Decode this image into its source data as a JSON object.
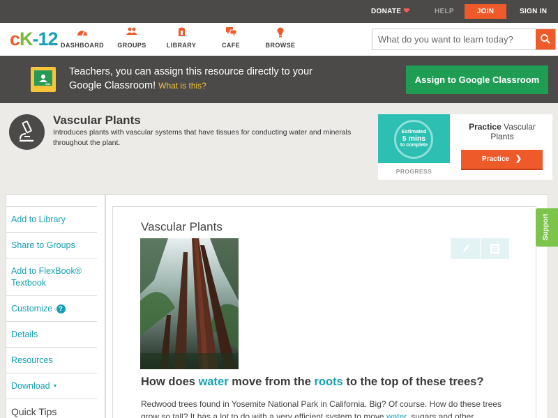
{
  "topbar": {
    "donate": "DONATE",
    "help": "HELP",
    "join": "JOIN",
    "signin": "SIGN IN"
  },
  "header": {
    "logo": {
      "c": "c",
      "k": "K",
      "n": "-12"
    },
    "nav": [
      {
        "label": "DASHBOARD",
        "icon": "dashboard-icon"
      },
      {
        "label": "GROUPS",
        "icon": "groups-icon"
      },
      {
        "label": "LIBRARY",
        "icon": "library-icon"
      },
      {
        "label": "CAFE",
        "icon": "cafe-icon"
      },
      {
        "label": "BROWSE",
        "icon": "browse-icon"
      }
    ],
    "search": {
      "placeholder": "What do you want to learn today?"
    }
  },
  "classroom": {
    "text": "Teachers, you can assign this resource directly to your Google Classroom!",
    "what": "What is this?",
    "button": "Assign to Google Classroom"
  },
  "concept": {
    "title": "Vascular Plants",
    "description": "Introduces plants with vascular systems that have tissues for conducting water and minerals throughout the plant."
  },
  "practice": {
    "estimated": "Estimated",
    "mins": "5 mins",
    "complete": "to complete",
    "progress_label": "PROGRESS",
    "label_bold": "Practice",
    "label_rest": "Vascular Plants",
    "button": "Practice"
  },
  "sidebar": {
    "items": [
      {
        "label": "Add to Library"
      },
      {
        "label": "Share to Groups"
      },
      {
        "label": "Add to FlexBook® Textbook"
      },
      {
        "label": "Customize"
      },
      {
        "label": "Details"
      },
      {
        "label": "Resources"
      },
      {
        "label": "Download"
      }
    ],
    "quick_tips": "Quick Tips"
  },
  "content": {
    "title": "Vascular Plants",
    "question": {
      "p1": "How does ",
      "w1": "water",
      "p2": " move from the ",
      "w2": "roots",
      "p3": " to the top of these trees?"
    },
    "paragraph": {
      "p1": "Redwood trees found in Yosemite National Park in California. Big? Of course. How do these trees grow so tall? It has a lot to do with a very efficient system to move ",
      "w1": "water",
      "p2": ", sugars and other"
    }
  },
  "support": "Support",
  "colors": {
    "accent_orange": "#ef5a2a",
    "accent_teal": "#17a0b4",
    "dark_bar": "#4b4a48",
    "classroom_green": "#1f9d55",
    "support_green": "#7cc44b"
  }
}
